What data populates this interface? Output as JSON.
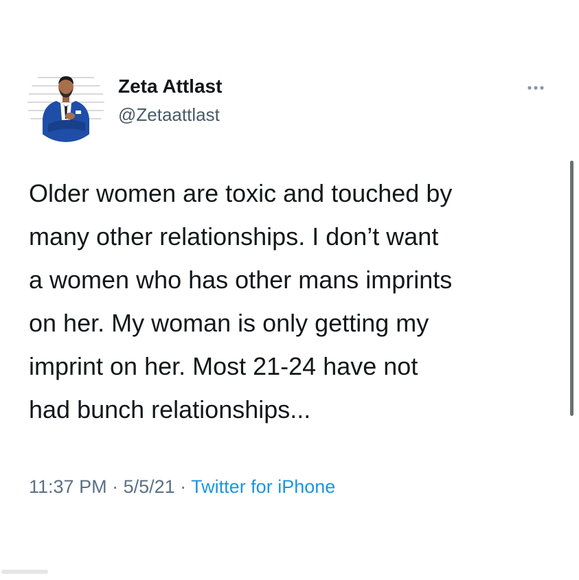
{
  "tweet": {
    "author": {
      "display_name": "Zeta Attlast",
      "handle": "@Zetaattlast"
    },
    "more_icon": "more-horizontal-icon",
    "text_lines": [
      "Older women are toxic and touched by",
      "many other relationships.  I don’t want",
      "a women who has other mans imprints",
      "on her.  My woman is only getting my",
      "imprint on her. Most 21-24 have not",
      "had bunch relationships..."
    ],
    "meta": {
      "time": "11:37 PM",
      "separator_1": " · ",
      "date": "5/5/21",
      "separator_2": " · ",
      "source": "Twitter for iPhone"
    }
  },
  "colors": {
    "text": "#14171a",
    "secondary": "#5b7083",
    "link": "#1b95e0",
    "suit_blue": "#1f4ea8",
    "background": "#ffffff"
  }
}
